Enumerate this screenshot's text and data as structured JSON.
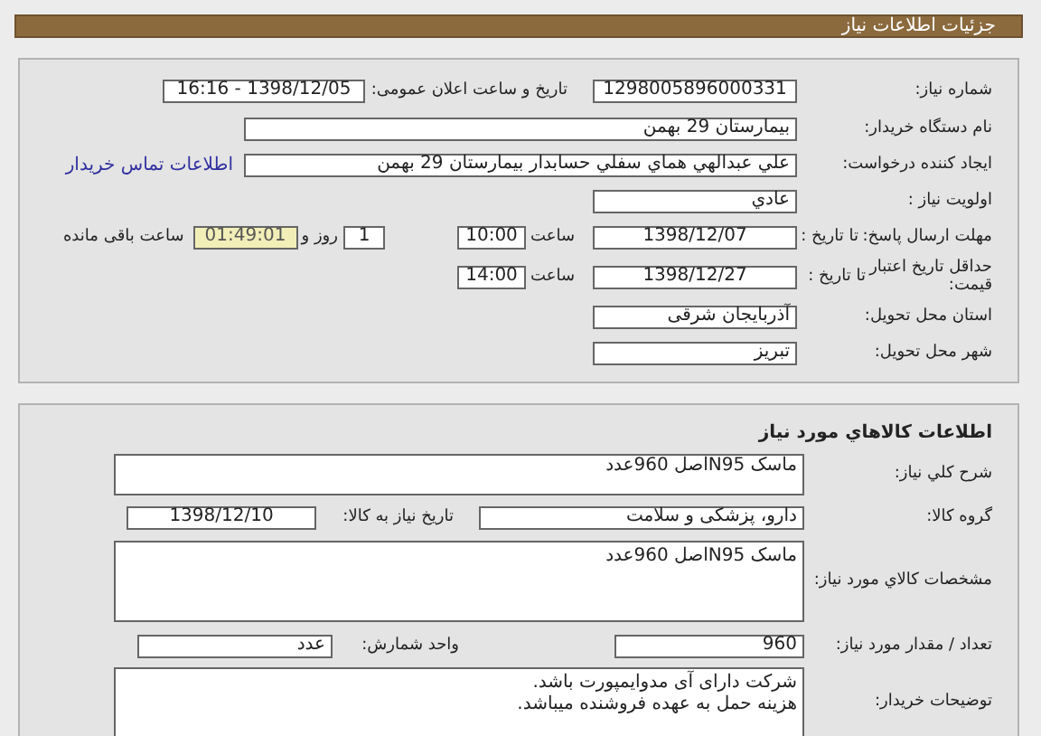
{
  "header": {
    "title": "جزئیات اطلاعات نیاز"
  },
  "request": {
    "need_number": {
      "label": "شماره نیاز:",
      "value": "1298005896000331"
    },
    "announce": {
      "label": "تاریخ و ساعت اعلان عمومی:",
      "value": "1398/12/05 - 16:16"
    },
    "buyer_org": {
      "label": "نام دستگاه خریدار:",
      "value": "بیمارستان 29 بهمن"
    },
    "creator": {
      "label": "ایجاد کننده درخواست:",
      "value": "علي عبدالهي هماي سفلي حسابدار بیمارستان 29 بهمن",
      "link": "اطلاعات تماس خریدار"
    },
    "priority": {
      "label": "اولویت نیاز :",
      "value": "عادي"
    },
    "deadline": {
      "label": "مهلت ارسال پاسخ:",
      "sub_label": "تا تاریخ :",
      "date": "1398/12/07",
      "time_label": "ساعت",
      "time": "10:00",
      "days": "1",
      "days_label": "روز و",
      "remaining": "01:49:01",
      "remaining_label": "ساعت باقی مانده"
    },
    "price_validity": {
      "label": "حداقل تاریخ اعتبار قیمت:",
      "sub_label": "تا تاریخ :",
      "date": "1398/12/27",
      "time_label": "ساعت",
      "time": "14:00"
    },
    "province": {
      "label": "استان محل تحویل:",
      "value": "آذربایجان شرقی"
    },
    "city": {
      "label": "شهر محل تحویل:",
      "value": "تبریز"
    }
  },
  "goods": {
    "title": "اطلاعات کالاهاي مورد نیاز",
    "description": {
      "label": "شرح کلي نیاز:",
      "value": "ماسک N95اصل 960عدد"
    },
    "group": {
      "label": "گروه کالا:",
      "value": "دارو، پزشکی و سلامت"
    },
    "need_date": {
      "label": "تاریخ نیاز به کالا:",
      "value": "1398/12/10"
    },
    "specs": {
      "label": "مشخصات کالاي مورد نیاز:",
      "value": "ماسک N95اصل 960عدد"
    },
    "quantity": {
      "label": "تعداد / مقدار مورد نیاز:",
      "value": "960"
    },
    "unit": {
      "label": "واحد شمارش:",
      "value": "عدد"
    },
    "notes": {
      "label": "توضیحات خریدار:",
      "lines": [
        "شرکت دارای آی مدوایمپورت باشد.",
        "هزینه حمل به عهده فروشنده میباشد."
      ]
    }
  }
}
